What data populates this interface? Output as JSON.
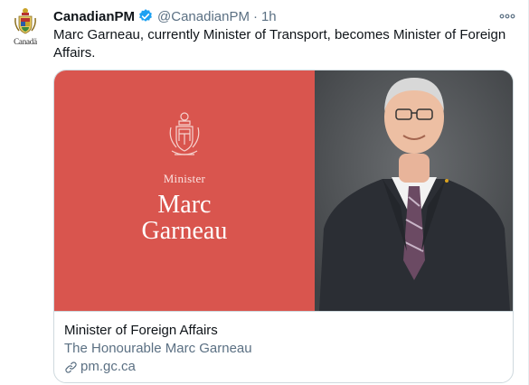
{
  "tweet": {
    "avatar_wordmark": "Canadä",
    "display_name": "CanadianPM",
    "handle": "@CanadianPM",
    "separator": "·",
    "time": "1h",
    "text": "Marc Garneau, currently Minister of Transport, becomes Minister of Foreign Affairs."
  },
  "card": {
    "image": {
      "role": "Minister",
      "name_line1": "Marc",
      "name_line2": "Garneau",
      "background_color": "#d9554e"
    },
    "title": "Minister of Foreign Affairs",
    "description": "The Honourable Marc Garneau",
    "domain": "pm.gc.ca"
  },
  "icons": {
    "verified": "verified-badge-icon",
    "more": "more-options-icon",
    "link": "link-icon",
    "crest": "coat-of-arms-icon"
  },
  "colors": {
    "verified_blue": "#1da1f2",
    "secondary_text": "#5b7083"
  }
}
